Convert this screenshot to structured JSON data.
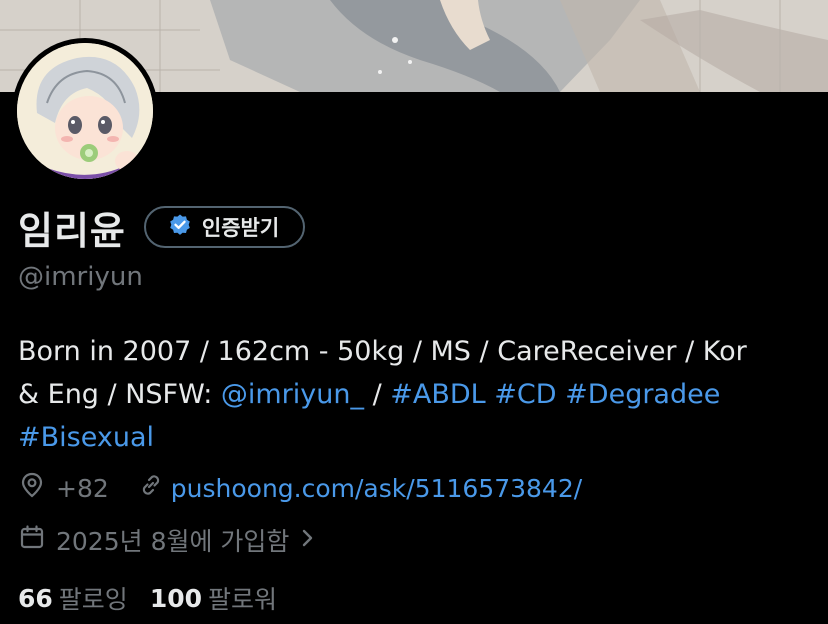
{
  "profile": {
    "display_name": "임리윤",
    "verify_label": "인증받기",
    "handle": "@imriyun",
    "bio": {
      "line1": "Born in 2007 / 162cm - 50kg / MS / CareReceiver / Kor",
      "line2_prefix": "& Eng / NSFW: ",
      "mention": "@imriyun_",
      "separator": " / ",
      "hashtag1": "#ABDL",
      "hashtag2": "#CD",
      "hashtag3": "#Degradee",
      "hashtag4": "#Bisexual"
    },
    "location": "+82",
    "website": "pushoong.com/ask/5116573842/",
    "joined": "2025년 8월에 가입함",
    "following_count": "66",
    "following_label": "팔로잉",
    "followers_count": "100",
    "followers_label": "팔로워"
  },
  "icons": {
    "location": "location-pin-icon",
    "link": "link-icon",
    "calendar": "calendar-icon",
    "chevron": "chevron-right-icon",
    "verified": "verified-badge-icon"
  },
  "colors": {
    "background": "#000000",
    "text": "#e7e9ea",
    "muted": "#71767b",
    "link": "#4a99e9",
    "button_border": "#536471"
  }
}
